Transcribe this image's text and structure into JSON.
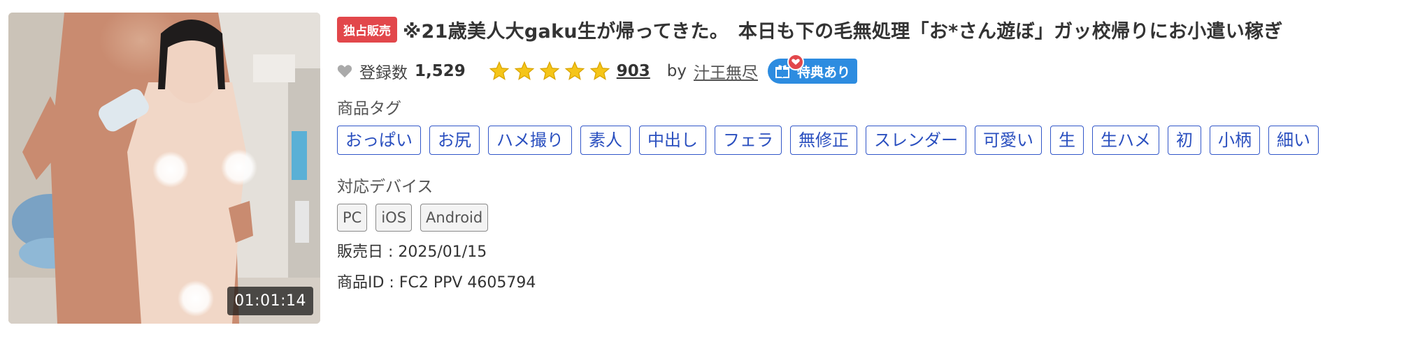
{
  "product": {
    "duration": "01:01:14",
    "exclusive_badge": "独占販売",
    "title": "※21歳美人大gaku生が帰ってきた。　本日も下の毛無処理「お*さん遊ぼ」ガッ校帰りにお小遣い稼ぎ",
    "registrations_label": "登録数",
    "registrations_count": "1,529",
    "rating_stars": 5,
    "review_count": "903",
    "by_label": "by",
    "seller": "汁王無尽",
    "bonus_label": "特典あり"
  },
  "tags_section": {
    "label": "商品タグ",
    "tags": [
      "おっぱい",
      "お尻",
      "ハメ撮り",
      "素人",
      "中出し",
      "フェラ",
      "無修正",
      "スレンダー",
      "可愛い",
      "生",
      "生ハメ",
      "初",
      "小柄",
      "細い"
    ]
  },
  "devices_section": {
    "label": "対応デバイス",
    "devices": [
      "PC",
      "iOS",
      "Android"
    ]
  },
  "details": {
    "release_date": "販売日 : 2025/01/15",
    "product_id": "商品ID : FC2 PPV 4605794"
  },
  "colors": {
    "tag_blue": "#2a4fbf",
    "star_yellow": "#f5c518",
    "exclusive_red": "#e2474b",
    "bonus_blue": "#2d8ce0"
  }
}
